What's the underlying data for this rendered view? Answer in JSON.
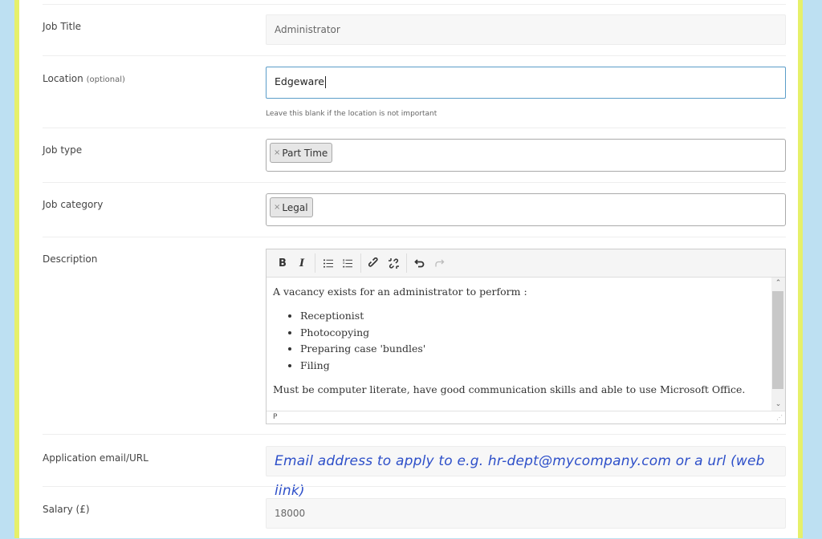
{
  "form": {
    "job_title": {
      "label": "Job Title",
      "value": "Administrator"
    },
    "location": {
      "label": "Location",
      "optional_tag": "(optional)",
      "value": "Edgeware",
      "hint": "Leave this blank if the location is not important"
    },
    "job_type": {
      "label": "Job type",
      "chips": [
        "Part Time"
      ],
      "remove_symbol": "×"
    },
    "job_category": {
      "label": "Job category",
      "chips": [
        "Legal"
      ],
      "remove_symbol": "×"
    },
    "description": {
      "label": "Description",
      "toolbar": {
        "bold": "B",
        "italic": "I",
        "bullet_list_icon": "bullet-list-icon",
        "numbered_list_icon": "numbered-list-icon",
        "link_icon": "link-icon",
        "unlink_icon": "unlink-icon",
        "undo_icon": "undo-icon",
        "redo_icon": "redo-icon"
      },
      "intro": "A vacancy exists for an administrator to perform :",
      "bullets": [
        "Receptionist",
        "Photocopying",
        "Preparing case 'bundles'",
        "Filing"
      ],
      "closing": "Must be computer literate, have good communication skills and able to use Microsoft Office.",
      "status_path": "P"
    },
    "application": {
      "label": "Application email/URL",
      "placeholder": "Email address to apply to e.g. hr-dept@mycompany.com or a url (web link)"
    },
    "salary": {
      "label": "Salary (£)",
      "value": "18000"
    }
  },
  "colors": {
    "side_background": "#bde0f2",
    "side_border": "#e6f06a",
    "annotation_ink": "#2d4fc9",
    "focus_border": "#5b9dc9"
  }
}
